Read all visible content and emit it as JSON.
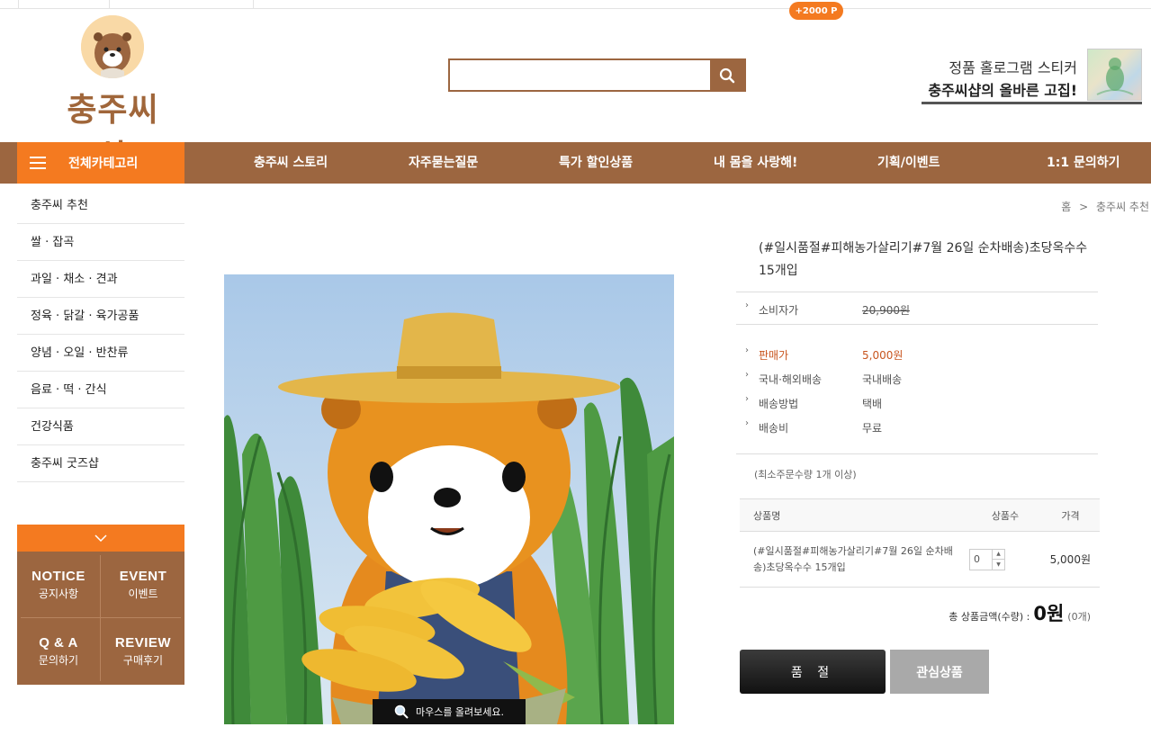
{
  "header": {
    "points_badge": "+2000 P",
    "logo_text": "충주씨샵",
    "search_placeholder": "",
    "hologram_line1": "정품 홀로그램 스티커",
    "hologram_line2": "충주씨샵의 올바른 고집!"
  },
  "nav": {
    "all_categories": "전체카테고리",
    "items": [
      "충주씨 스토리",
      "자주묻는질문",
      "특가 할인상품",
      "내 몸을 사랑해!",
      "기획/이벤트",
      "1:1 문의하기"
    ]
  },
  "sidebar": {
    "categories": [
      "충주씨 추천",
      "쌀 · 잡곡",
      "과일 · 채소 · 견과",
      "정육 · 닭갈 · 육가공품",
      "양념 · 오일 · 반찬류",
      "음료 · 떡 · 간식",
      "건강식품",
      "충주씨 굿즈샵"
    ],
    "boxes": [
      {
        "en": "NOTICE",
        "ko": "공지사항"
      },
      {
        "en": "EVENT",
        "ko": "이벤트"
      },
      {
        "en": "Q & A",
        "ko": "문의하기"
      },
      {
        "en": "REVIEW",
        "ko": "구매후기"
      }
    ]
  },
  "breadcrumb": {
    "home": "홈",
    "separator": ">",
    "current": "충주씨 추천"
  },
  "product": {
    "image_hint": "마우스를 올려보세요.",
    "title": "(#일시품절#피해농가살리기#7월 26일 순차배송)초당옥수수 15개입",
    "consumer_price_label": "소비자가",
    "consumer_price": "20,900원",
    "sale_price_label": "판매가",
    "sale_price": "5,000원",
    "shipping_scope_label": "국내·해외배송",
    "shipping_scope": "국내배송",
    "shipping_method_label": "배송방법",
    "shipping_method": "택배",
    "shipping_fee_label": "배송비",
    "shipping_fee": "무료",
    "min_order": "(최소주문수량 1개 이상)"
  },
  "order_table": {
    "headers": [
      "상품명",
      "상품수",
      "가격"
    ],
    "row": {
      "name": "(#일시품절#피해농가살리기#7월 26일 순차배송)초당옥수수 15개입",
      "qty": "0",
      "price": "5,000원"
    }
  },
  "total": {
    "label": "총 상품금액(수량) :",
    "amount": "0원",
    "count": "(0개)"
  },
  "buttons": {
    "soldout": "품 절",
    "wishlist": "관심상품"
  },
  "colors": {
    "brand_brown": "#9c6640",
    "accent_orange": "#f47a20",
    "sale_price": "#c8551e"
  }
}
